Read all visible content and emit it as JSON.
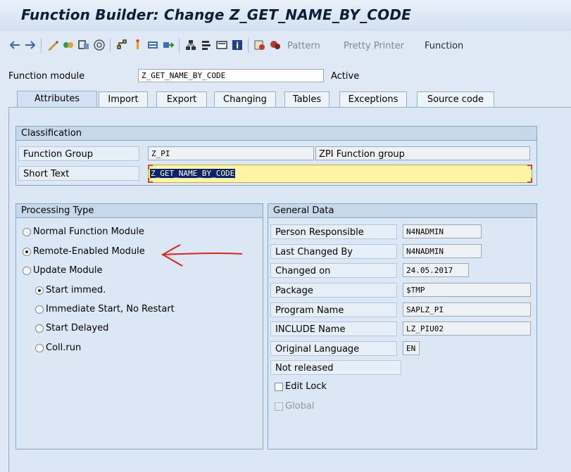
{
  "title": "Function Builder: Change Z_GET_NAME_BY_CODE",
  "toolbar": {
    "icons": [
      "back-arrow",
      "forward-arrow",
      "display-change",
      "check",
      "activate",
      "where-used",
      "hierarchy",
      "other-object",
      "display-object-list",
      "navigate",
      "tree",
      "layout",
      "screen",
      "info",
      "display-function",
      "enhance"
    ],
    "text_buttons": [
      "Pattern",
      "Pretty Printer",
      "Function"
    ]
  },
  "header": {
    "function_module_label": "Function module",
    "function_module_value": "Z_GET_NAME_BY_CODE",
    "status": "Active"
  },
  "tabs": [
    "Attributes",
    "Import",
    "Export",
    "Changing",
    "Tables",
    "Exceptions",
    "Source code"
  ],
  "active_tab": "Attributes",
  "classification": {
    "title": "Classification",
    "function_group_label": "Function Group",
    "function_group_value": "Z_PI",
    "function_group_desc": "ZPI Function group",
    "short_text_label": "Short Text",
    "short_text_value": "Z_GET_NAME_BY_CODE"
  },
  "processing_type": {
    "title": "Processing Type",
    "options": [
      {
        "label": "Normal Function Module",
        "selected": false
      },
      {
        "label": "Remote-Enabled Module",
        "selected": true
      },
      {
        "label": "Update Module",
        "selected": false
      }
    ],
    "update_options": [
      {
        "label": "Start immed.",
        "selected": true
      },
      {
        "label": "Immediate Start, No Restart",
        "selected": false
      },
      {
        "label": "Start Delayed",
        "selected": false
      },
      {
        "label": "Coll.run",
        "selected": false
      }
    ]
  },
  "general_data": {
    "title": "General Data",
    "rows": [
      {
        "label": "Person Responsible",
        "value": "N4NADMIN"
      },
      {
        "label": "Last Changed By",
        "value": "N4NADMIN"
      },
      {
        "label": "Changed on",
        "value": "24.05.2017"
      },
      {
        "label": "Package",
        "value": "$TMP"
      },
      {
        "label": "Program Name",
        "value": "SAPLZ_PI"
      },
      {
        "label": "INCLUDE Name",
        "value": "LZ_PIU02"
      },
      {
        "label": "Original Language",
        "value": "EN"
      }
    ],
    "release_status": "Not released",
    "edit_lock_label": "Edit Lock",
    "global_label": "Global"
  },
  "colors": {
    "annotation_arrow": "#e02020",
    "highlight": "#fff3a6",
    "selection": "#0a246a"
  }
}
